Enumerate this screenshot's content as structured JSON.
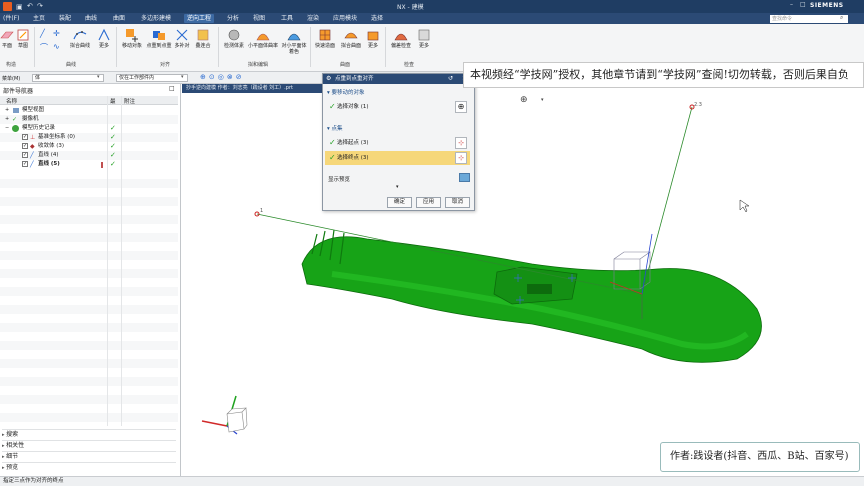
{
  "window": {
    "title": "NX - 建模",
    "brand": "SIEMENS",
    "search_placeholder": "查找命令"
  },
  "menubar": {
    "items": [
      "(件(F)",
      "主页",
      "装配",
      "曲线",
      "曲面",
      "多边形建模",
      "逆向工程",
      "分析",
      "视图",
      "工具",
      "渲染",
      "应用模块",
      "选择"
    ],
    "active_index": 6
  },
  "ribbon": {
    "groups": [
      {
        "label": "构造",
        "buttons": [
          "平面",
          "草图"
        ]
      },
      {
        "label": "曲线",
        "buttons": [
          "拟合曲线",
          "更多"
        ]
      },
      {
        "label": "对齐",
        "buttons": [
          "移动对象",
          "点重到点重",
          "多补对",
          "叠连合"
        ]
      },
      {
        "label": "拟和编辑",
        "buttons": [
          "检测体素",
          "小平面体曲率",
          "对小平面体着色"
        ]
      },
      {
        "label": "曲面",
        "buttons": [
          "快速造面",
          "拟合曲面",
          "更多"
        ]
      },
      {
        "label": "检查",
        "buttons": [
          "偏差检查",
          "更多"
        ]
      }
    ]
  },
  "selbar": {
    "filter": "菜单(M)",
    "combo1": "体",
    "combo2": "仅在工作部件内"
  },
  "nav": {
    "title": "部件导航器",
    "columns": [
      "名称",
      "最",
      "附注"
    ],
    "rows": [
      {
        "label": "模型视图",
        "depth": 1,
        "check": false,
        "bold": false
      },
      {
        "label": "摄像机",
        "depth": 1,
        "check": true,
        "bold": false
      },
      {
        "label": "模型历史记录",
        "depth": 1,
        "check": true,
        "bold": false
      },
      {
        "label": "基准坐标系 (0)",
        "depth": 2,
        "check": true,
        "bold": false
      },
      {
        "label": "收敛体 (3)",
        "depth": 2,
        "check": true,
        "bold": false
      },
      {
        "label": "直线 (4)",
        "depth": 2,
        "check": true,
        "bold": false
      },
      {
        "label": "直线 (5)",
        "depth": 2,
        "check": true,
        "bold": true
      }
    ],
    "folds": [
      "搜索",
      "相关性",
      "细节",
      "预览"
    ]
  },
  "viewport": {
    "tab": "抄手逆向建模 作者：刘志亮（践设者 刘工）.prt",
    "labels": {
      "top_point": "2.3",
      "left_point": "1"
    }
  },
  "dialog": {
    "title": "点重到点重对齐",
    "section1": "要移动的对象",
    "row1": "选择对象 (1)",
    "section2": "点集",
    "row2": "选择起点 (3)",
    "row3": "选择终点 (3)",
    "preview": "显示预览",
    "ok": "确定",
    "apply": "应用",
    "cancel": "取消"
  },
  "notice": "本视频经“学技网”授权，其他章节请到“学技网”查阅!切勿转载，否则后果自负",
  "author": "作者:践设者(抖音、西瓜、B站、百家号)",
  "status": "指定三点作为对齐的终点",
  "colors": {
    "accent": "#2b4a75",
    "model": "#1fa81f",
    "highlight": "#f6d77a"
  }
}
